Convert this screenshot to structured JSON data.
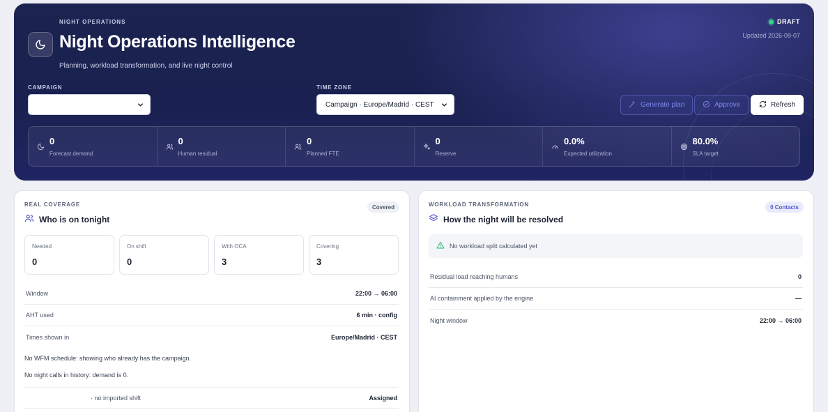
{
  "hero": {
    "eyebrow": "NIGHT OPERATIONS",
    "title": "Night Operations Intelligence",
    "subtitle": "Planning, workload transformation, and live night control",
    "status": "DRAFT",
    "updated": "Updated 2026-09-07",
    "campaign_label": "CAMPAIGN",
    "campaign_value": "",
    "timezone_label": "TIME ZONE",
    "timezone_value": "Campaign · Europe/Madrid · CEST",
    "buttons": {
      "generate": "Generate plan",
      "approve": "Approve",
      "refresh": "Refresh"
    },
    "kpis": [
      {
        "icon": "moon-icon",
        "value": "0",
        "label": "Forecast demand"
      },
      {
        "icon": "users-icon",
        "value": "0",
        "label": "Human residual"
      },
      {
        "icon": "users-icon",
        "value": "0",
        "label": "Planned FTE"
      },
      {
        "icon": "sparkles-icon",
        "value": "0",
        "label": "Reserve"
      },
      {
        "icon": "gauge-icon",
        "value": "0.0%",
        "label": "Expected utilization"
      },
      {
        "icon": "target-icon",
        "value": "80.0%",
        "label": "SLA target"
      }
    ]
  },
  "coverage": {
    "eyebrow": "REAL COVERAGE",
    "title": "Who is on tonight",
    "badge": "Covered",
    "stats": [
      {
        "label": "Needed",
        "value": "0"
      },
      {
        "label": "On shift",
        "value": "0"
      },
      {
        "label": "With OCA",
        "value": "3"
      },
      {
        "label": "Covering",
        "value": "3"
      }
    ],
    "rows": [
      {
        "key": "Window",
        "value": "22:00 → 06:00"
      },
      {
        "key": "AHT used",
        "value": "6 min · config"
      },
      {
        "key": "Times shown in",
        "value": "Europe/Madrid · CEST"
      }
    ],
    "notes": [
      "No WFM schedule: showing who already has the campaign.",
      "No night calls in history: demand is 0."
    ],
    "agent_row": {
      "shift": "· no imported shift",
      "status": "Assigned"
    }
  },
  "workload": {
    "eyebrow": "WORKLOAD TRANSFORMATION",
    "title": "How the night will be resolved",
    "badge": "0 Contacts",
    "notice": "No workload split calculated yet",
    "rows": [
      {
        "key": "Residual load reaching humans",
        "value": "0"
      },
      {
        "key": "AI containment applied by the engine",
        "value": "—"
      },
      {
        "key": "Night window",
        "value": "22:00 → 06:00"
      }
    ]
  },
  "colors": {
    "hero_bg": "#1b2350",
    "accent": "#7d87ea",
    "status_green": "#3ecf8e",
    "notice_green": "#2bb673"
  }
}
